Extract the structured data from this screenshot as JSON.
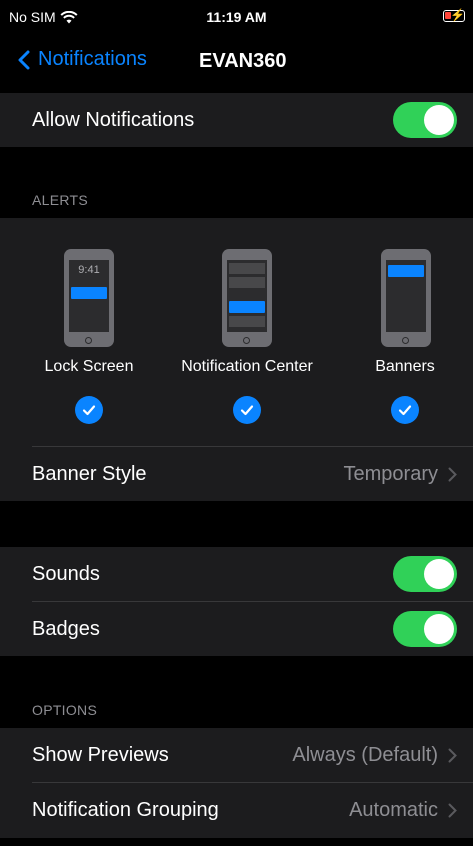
{
  "status": {
    "carrier": "No SIM",
    "time": "11:19 AM"
  },
  "nav": {
    "back_label": "Notifications",
    "title": "EVAN360"
  },
  "allow": {
    "label": "Allow Notifications",
    "on": true
  },
  "alerts": {
    "header": "ALERTS",
    "lock_time": "9:41",
    "items": [
      {
        "label": "Lock Screen",
        "checked": true
      },
      {
        "label": "Notification Center",
        "checked": true
      },
      {
        "label": "Banners",
        "checked": true
      }
    ],
    "banner_style": {
      "label": "Banner Style",
      "value": "Temporary"
    }
  },
  "sounds": {
    "label": "Sounds",
    "on": true
  },
  "badges": {
    "label": "Badges",
    "on": true
  },
  "options": {
    "header": "OPTIONS",
    "show_previews": {
      "label": "Show Previews",
      "value": "Always (Default)"
    },
    "grouping": {
      "label": "Notification Grouping",
      "value": "Automatic"
    }
  },
  "colors": {
    "accent": "#0a84ff",
    "toggle_on": "#30d158",
    "background": "#000000",
    "cell": "#1c1c1e"
  }
}
